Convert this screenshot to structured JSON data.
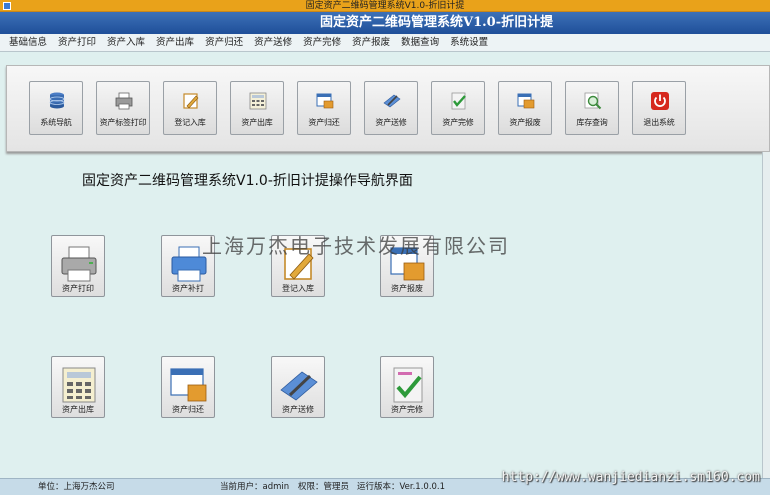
{
  "window": {
    "title": "固定资产二维码管理系统V1.0-折旧计提"
  },
  "banner": {
    "title": "固定资产二维码管理系统V1.0-折旧计提"
  },
  "menu": [
    {
      "label": "基础信息"
    },
    {
      "label": "资产打印"
    },
    {
      "label": "资产入库"
    },
    {
      "label": "资产出库"
    },
    {
      "label": "资产归还"
    },
    {
      "label": "资产送修"
    },
    {
      "label": "资产完修"
    },
    {
      "label": "资产报废"
    },
    {
      "label": "数据查询"
    },
    {
      "label": "系统设置"
    }
  ],
  "toolbar": [
    {
      "label": "系统导航",
      "icon": "database-icon"
    },
    {
      "label": "资产标签打印",
      "icon": "printer-icon"
    },
    {
      "label": "登记入库",
      "icon": "edit-pencil-icon"
    },
    {
      "label": "资产出库",
      "icon": "calculator-icon"
    },
    {
      "label": "资产归还",
      "icon": "window-box-icon"
    },
    {
      "label": "资产送修",
      "icon": "wrench-icon"
    },
    {
      "label": "资产完修",
      "icon": "checkmark-icon"
    },
    {
      "label": "资产报废",
      "icon": "box-window-icon"
    },
    {
      "label": "库存查询",
      "icon": "magnifier-icon"
    },
    {
      "label": "退出系统",
      "icon": "power-icon"
    }
  ],
  "main": {
    "title": "固定资产二维码管理系统V1.0-折旧计提操作导航界面",
    "buttons": [
      {
        "label": "资产打印",
        "icon": "printer-icon"
      },
      {
        "label": "资产补打",
        "icon": "blue-printer-icon"
      },
      {
        "label": "登记入库",
        "icon": "edit-pencil-icon"
      },
      {
        "label": "资产报废",
        "icon": "box-window-icon"
      },
      {
        "label": "资产出库",
        "icon": "calculator-icon"
      },
      {
        "label": "资产归还",
        "icon": "window-box-icon"
      },
      {
        "label": "资产送修",
        "icon": "wrench-icon"
      },
      {
        "label": "资产完修",
        "icon": "checkmark-icon"
      }
    ]
  },
  "watermark": "上海万杰电子技术发展有限公司",
  "status": {
    "unit": "单位：上海万杰公司",
    "user": "当前用户：admin",
    "role": "权限：管理员",
    "version": "运行版本：Ver.1.0.0.1"
  },
  "site_watermark": "http://www.wanjiedianzi.sm160.com"
}
